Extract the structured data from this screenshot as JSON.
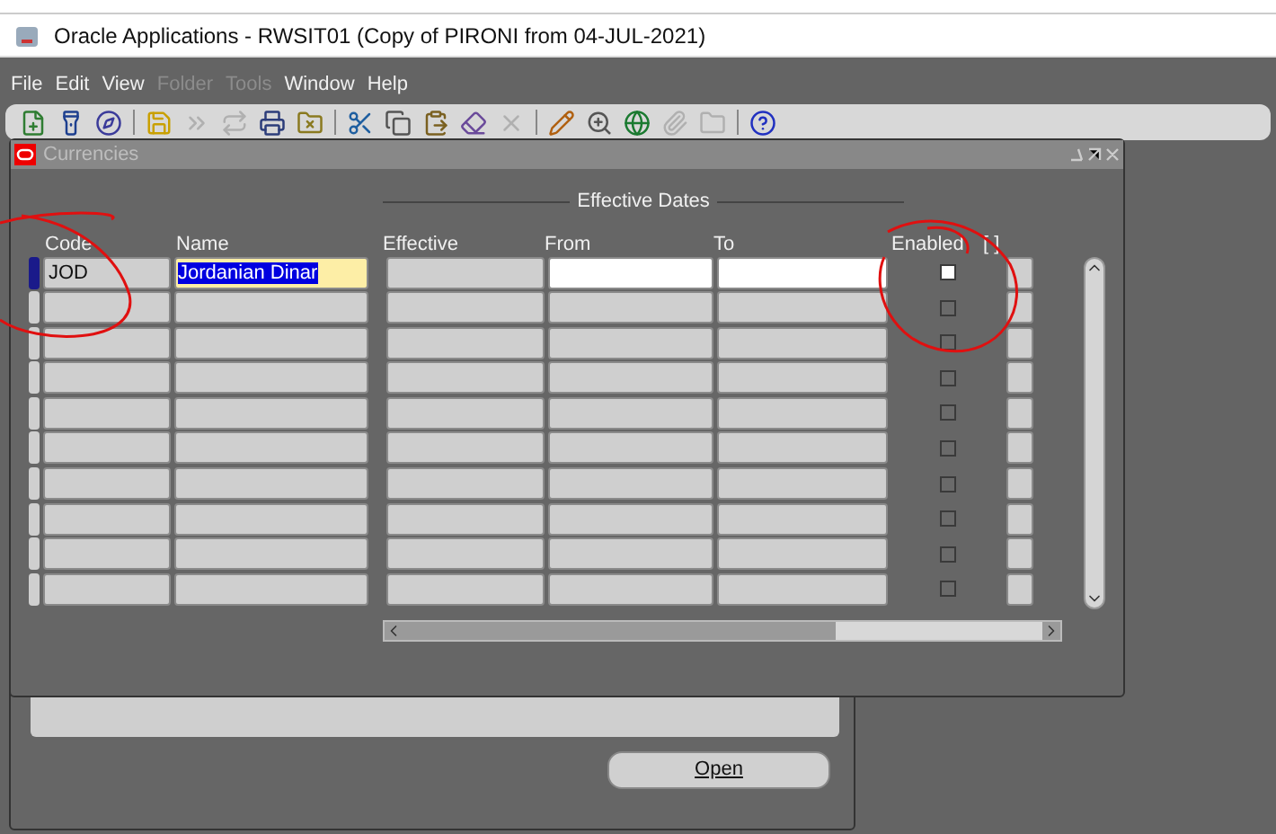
{
  "app_window": {
    "title": "Oracle Applications - RWSIT01 (Copy of PIRONI from 04-JUL-2021)"
  },
  "menu": [
    {
      "label": "File",
      "disabled": false
    },
    {
      "label": "Edit",
      "disabled": false
    },
    {
      "label": "View",
      "disabled": false
    },
    {
      "label": "Folder",
      "disabled": true
    },
    {
      "label": "Tools",
      "disabled": true
    },
    {
      "label": "Window",
      "disabled": false
    },
    {
      "label": "Help",
      "disabled": false
    }
  ],
  "toolbar": [
    {
      "kind": "new",
      "disabled": false
    },
    {
      "kind": "find",
      "disabled": false
    },
    {
      "kind": "navigate",
      "disabled": false
    },
    {
      "kind": "sep"
    },
    {
      "kind": "save",
      "disabled": false
    },
    {
      "kind": "next",
      "disabled": true
    },
    {
      "kind": "switch",
      "disabled": true
    },
    {
      "kind": "print",
      "disabled": false
    },
    {
      "kind": "close",
      "disabled": false
    },
    {
      "kind": "sep"
    },
    {
      "kind": "cut",
      "disabled": false
    },
    {
      "kind": "copy",
      "disabled": false
    },
    {
      "kind": "paste",
      "disabled": false
    },
    {
      "kind": "clear",
      "disabled": false
    },
    {
      "kind": "delete",
      "disabled": true
    },
    {
      "kind": "sep"
    },
    {
      "kind": "edit",
      "disabled": false
    },
    {
      "kind": "zoom",
      "disabled": false
    },
    {
      "kind": "translate",
      "disabled": false
    },
    {
      "kind": "attach",
      "disabled": true
    },
    {
      "kind": "folder",
      "disabled": true
    },
    {
      "kind": "sep"
    },
    {
      "kind": "help",
      "disabled": false
    }
  ],
  "form": {
    "title": "Currencies",
    "group_label": "Effective Dates",
    "columns": [
      "Code",
      "Name",
      "Effective",
      "From",
      "To",
      "Enabled",
      "[ ]"
    ],
    "rows": [
      {
        "code": "JOD",
        "name": "Jordanian Dinar",
        "selected": true,
        "enabled": false
      },
      {
        "selected": false,
        "enabled": false
      },
      {
        "selected": false,
        "enabled": false
      },
      {
        "selected": false,
        "enabled": false
      },
      {
        "selected": false,
        "enabled": false
      },
      {
        "selected": false,
        "enabled": false
      },
      {
        "selected": false,
        "enabled": false
      },
      {
        "selected": false,
        "enabled": false
      },
      {
        "selected": false,
        "enabled": false
      },
      {
        "selected": false,
        "enabled": false
      }
    ]
  },
  "back_window": {
    "button": "Open"
  }
}
